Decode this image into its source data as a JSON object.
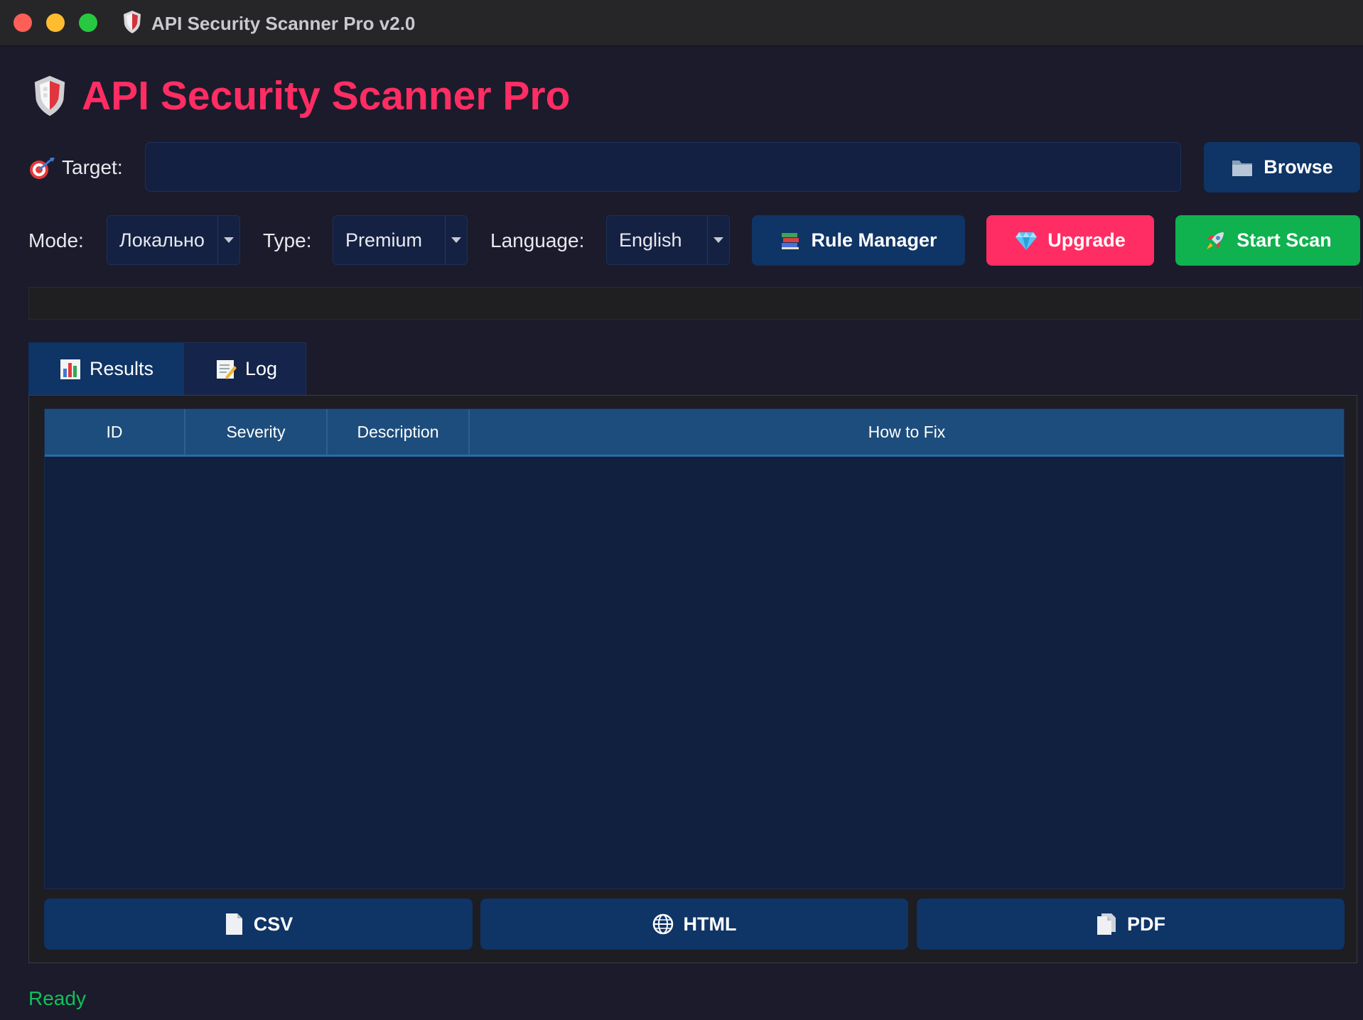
{
  "window": {
    "title": "API Security Scanner Pro v2.0"
  },
  "header": {
    "title": "API Security Scanner Pro"
  },
  "target": {
    "label": "Target:",
    "value": "",
    "browse_label": "Browse"
  },
  "controls": {
    "mode_label": "Mode:",
    "mode_value": "Локально",
    "type_label": "Type:",
    "type_value": "Premium",
    "language_label": "Language:",
    "language_value": "English",
    "rule_manager_label": "Rule Manager",
    "upgrade_label": "Upgrade",
    "start_scan_label": "Start Scan"
  },
  "progress": {
    "value_percent": 0
  },
  "tabs": [
    {
      "label": "Results",
      "icon": "bar-chart-icon",
      "active": true
    },
    {
      "label": "Log",
      "icon": "memo-icon",
      "active": false
    }
  ],
  "results_table": {
    "columns": [
      "ID",
      "Severity",
      "Description",
      "How to Fix"
    ],
    "rows": []
  },
  "export": {
    "csv_label": "CSV",
    "html_label": "HTML",
    "pdf_label": "PDF"
  },
  "status": {
    "text": "Ready"
  },
  "colors": {
    "brand_pink": "#ff2d63",
    "start_green": "#10b14f",
    "button_navy": "#0f3466",
    "status_green": "#10c15a",
    "table_header": "#1d4d7c"
  }
}
